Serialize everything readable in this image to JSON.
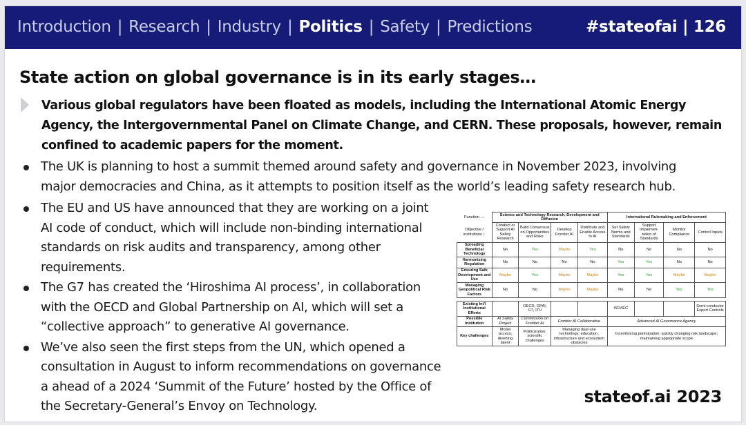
{
  "header": {
    "nav": [
      {
        "label": "Introduction",
        "active": false
      },
      {
        "label": "Research",
        "active": false
      },
      {
        "label": "Industry",
        "active": false
      },
      {
        "label": "Politics",
        "active": true
      },
      {
        "label": "Safety",
        "active": false
      },
      {
        "label": "Predictions",
        "active": false
      }
    ],
    "separator": "|",
    "tagline": "#stateofai | 126"
  },
  "title": "State action on global governance is in its early stages…",
  "lead": "Various global regulators have been floated as models, including the International Atomic Energy Agency, the Intergovernmental Panel on Climate Change, and CERN. These proposals, however, remain confined to academic papers for the moment.",
  "bullets": [
    "The UK is planning to host a summit themed around safety and governance in November 2023, involving major democracies and China, as it attempts to position itself as the world’s leading safety research hub.",
    "The EU and US have announced that they are working on a joint AI code of conduct, which will include non-binding international standards on risk audits and transparency, among other requirements.",
    "The G7 has created the ‘Hiroshima AI process’, in collaboration with the OECD and Global Partnership on AI, which will set a “collective approach” to generative AI governance.",
    "We’ve also seen the first steps from the UN, which opened a consultation in August to inform recommendations on governance a ahead of a 2024 ‘Summit of the Future’ hosted by the Office of the Secretary-General’s Envoy on Technology."
  ],
  "figure": {
    "function_label": "Function →",
    "groups": [
      "Science and Technology Research, Development and Diffusion",
      "International Rulemaking and Enforcement"
    ],
    "corner_label": "Objective / institutions ↓",
    "columns": [
      "Conduct or Support AI Safety Research",
      "Build Consensus on Opportunities and Risks",
      "Develop Frontier AI",
      "Distribute and Enable Access to AI",
      "Set Safety Norms and Standards",
      "Support Implemen-tation of Standards",
      "Monitor Compliance",
      "Control Inputs"
    ],
    "rows": [
      {
        "label": "Spreading Beneficial Technology",
        "cells": [
          "No",
          "Yes",
          "Maybe",
          "Yes",
          "No",
          "No",
          "No",
          "No"
        ]
      },
      {
        "label": "Harmonizing Regulation",
        "cells": [
          "No",
          "No",
          "No",
          "No",
          "Yes",
          "Yes",
          "No",
          "No"
        ]
      },
      {
        "label": "Ensuring Safe Development and Use",
        "cells": [
          "Maybe",
          "Yes",
          "Maybe",
          "Maybe",
          "Yes",
          "Yes",
          "Maybe",
          "Maybe"
        ]
      },
      {
        "label": "Managing Geopolitical Risk Factors",
        "cells": [
          "No",
          "No",
          "Maybe",
          "Maybe",
          "No",
          "No",
          "Yes",
          "Yes"
        ]
      }
    ],
    "existing": {
      "label": "Existing Int’l Institutional Efforts",
      "c2": "OECD, GPAI, G7, ITU",
      "c5": "ISO/IEC",
      "c8": "Semi-conductor Export Controls"
    },
    "possible": {
      "label": "Possible Institution",
      "c1": "AI Safety Project",
      "c2": "Commission on Frontier AI",
      "c34": "Frontier AI Collaborative",
      "c58": "Advanced AI Governance Agency"
    },
    "challenges": {
      "label": "Key challenges",
      "c1": "Model access; diverting talent",
      "c2": "Politicization; scientific challenges",
      "c34": "Managing dual-use technology; education, infrastructure and ecosystem obstacles",
      "c58": "Incentivizing participation; quickly changing risk landscape; maintaining appropriate scope"
    }
  },
  "brand": "stateof.ai 2023",
  "colors": {
    "header_bg": "#151b77",
    "yes": "#2e9a2e",
    "maybe": "#c98413"
  }
}
